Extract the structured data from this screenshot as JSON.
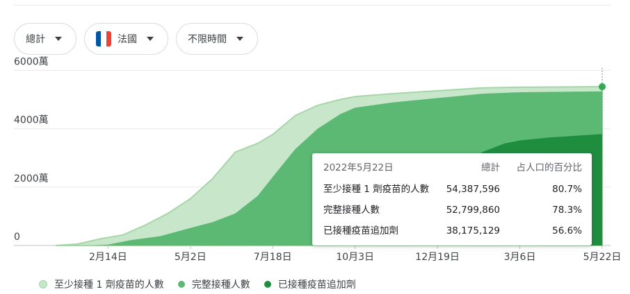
{
  "filters": [
    {
      "label": "總計"
    },
    {
      "label": "法國",
      "flag_colors": [
        "#0055a4",
        "#ffffff",
        "#ef4135"
      ]
    },
    {
      "label": "不限時間"
    }
  ],
  "colors": {
    "at_least_one": "#c8e6c9",
    "at_least_one_edge": "#a5d6a7",
    "fully": "#5bb974",
    "booster": "#1e8e3e",
    "grid": "#e8eaed",
    "axis": "#5f6368",
    "end_marker": "#34a853"
  },
  "chart_data": {
    "type": "area",
    "stacking": "overlapping cumulative",
    "ylim": [
      0,
      62000000
    ],
    "y_ticks": [
      {
        "value": 0,
        "label": "0"
      },
      {
        "value": 20000000,
        "label": "2000萬"
      },
      {
        "value": 40000000,
        "label": "4000萬"
      },
      {
        "value": 60000000,
        "label": "6000萬"
      }
    ],
    "x_domain": [
      "2020-12-27",
      "2022-05-22"
    ],
    "x_ticks": [
      {
        "date": "2021-02-14",
        "label": "2月14日"
      },
      {
        "date": "2021-05-02",
        "label": "5月2日"
      },
      {
        "date": "2021-07-18",
        "label": "7月18日"
      },
      {
        "date": "2021-10-03",
        "label": "10月3日"
      },
      {
        "date": "2021-12-19",
        "label": "12月19日"
      },
      {
        "date": "2022-03-06",
        "label": "3月6日"
      },
      {
        "date": "2022-05-22",
        "label": "5月22日"
      }
    ],
    "series": [
      {
        "key": "at_least_one",
        "name": "至少接種 1 劑疫苗的人數",
        "points": [
          [
            "2020-12-27",
            0
          ],
          [
            "2021-01-17",
            500000
          ],
          [
            "2021-02-07",
            2300000
          ],
          [
            "2021-02-28",
            3600000
          ],
          [
            "2021-03-21",
            7000000
          ],
          [
            "2021-04-11",
            11000000
          ],
          [
            "2021-05-02",
            16000000
          ],
          [
            "2021-05-23",
            23000000
          ],
          [
            "2021-06-13",
            32000000
          ],
          [
            "2021-07-04",
            35000000
          ],
          [
            "2021-07-18",
            38000000
          ],
          [
            "2021-08-08",
            44500000
          ],
          [
            "2021-08-29",
            48000000
          ],
          [
            "2021-09-19",
            50000000
          ],
          [
            "2021-10-03",
            51000000
          ],
          [
            "2021-11-07",
            52000000
          ],
          [
            "2021-12-19",
            53000000
          ],
          [
            "2022-01-30",
            54000000
          ],
          [
            "2022-03-06",
            54200000
          ],
          [
            "2022-05-22",
            54387596
          ]
        ],
        "tooltip_total": "54,387,596",
        "tooltip_pct": "80.7%"
      },
      {
        "key": "fully",
        "name": "完整接種人數",
        "points": [
          [
            "2020-12-27",
            0
          ],
          [
            "2021-01-31",
            0
          ],
          [
            "2021-02-14",
            300000
          ],
          [
            "2021-03-07",
            1800000
          ],
          [
            "2021-04-04",
            3200000
          ],
          [
            "2021-05-02",
            6000000
          ],
          [
            "2021-05-23",
            8000000
          ],
          [
            "2021-06-13",
            11000000
          ],
          [
            "2021-07-04",
            17000000
          ],
          [
            "2021-07-18",
            23500000
          ],
          [
            "2021-08-08",
            33000000
          ],
          [
            "2021-08-29",
            40000000
          ],
          [
            "2021-09-19",
            45000000
          ],
          [
            "2021-10-03",
            47200000
          ],
          [
            "2021-11-07",
            49000000
          ],
          [
            "2021-12-19",
            50500000
          ],
          [
            "2022-01-30",
            52000000
          ],
          [
            "2022-03-06",
            52500000
          ],
          [
            "2022-05-22",
            52799860
          ]
        ],
        "tooltip_total": "52,799,860",
        "tooltip_pct": "78.3%"
      },
      {
        "key": "booster",
        "name": "已接種疫苗追加劑",
        "points": [
          [
            "2020-12-27",
            0
          ],
          [
            "2021-08-29",
            0
          ],
          [
            "2021-09-19",
            500000
          ],
          [
            "2021-10-03",
            1500000
          ],
          [
            "2021-10-24",
            3000000
          ],
          [
            "2021-11-14",
            5000000
          ],
          [
            "2021-12-05",
            11000000
          ],
          [
            "2021-12-19",
            17000000
          ],
          [
            "2022-01-09",
            26000000
          ],
          [
            "2022-01-30",
            32000000
          ],
          [
            "2022-02-20",
            35000000
          ],
          [
            "2022-03-06",
            36000000
          ],
          [
            "2022-04-03",
            37000000
          ],
          [
            "2022-05-22",
            38175129
          ]
        ],
        "tooltip_total": "38,175,129",
        "tooltip_pct": "56.6%"
      }
    ]
  },
  "tooltip": {
    "date": "2022年5月22日",
    "col_total": "總計",
    "col_pct": "占人口的百分比"
  }
}
